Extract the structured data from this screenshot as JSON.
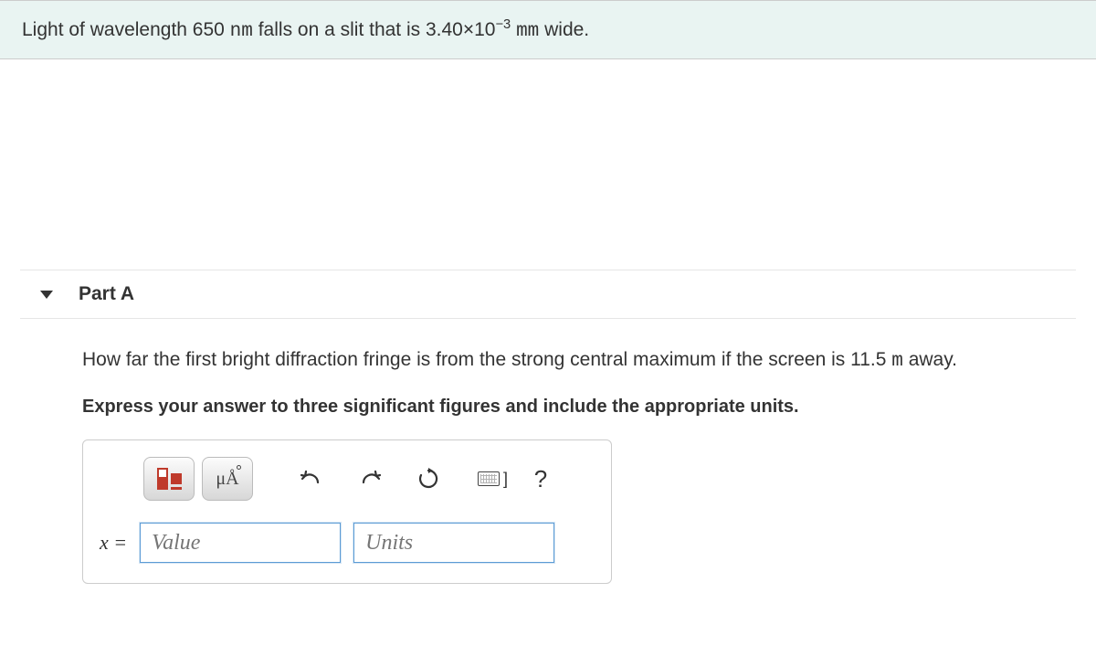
{
  "problem": {
    "pre_text": "Light of wavelength 650 ",
    "unit1": "nm",
    "mid_text1": " falls on a slit that is 3.40×10",
    "exp": "−3",
    "post_unit_gap": "  ",
    "unit2": "mm",
    "end_text": " wide."
  },
  "part": {
    "label": "Part A",
    "question_pre": "How far the first bright diffraction fringe is from the strong central maximum if the screen is 11.5 ",
    "question_unit": "m",
    "question_post": " away.",
    "instruction": "Express your answer to three significant figures and include the appropriate units."
  },
  "toolbar": {
    "templates_icon": "templates-icon",
    "symbols_text": "μÅ",
    "undo_icon": "undo-icon",
    "redo_icon": "redo-icon",
    "reset_icon": "reset-icon",
    "keyboard_icon": "keyboard-icon",
    "help_text": "?"
  },
  "answer": {
    "variable": "x =",
    "value_placeholder": "Value",
    "units_placeholder": "Units"
  }
}
